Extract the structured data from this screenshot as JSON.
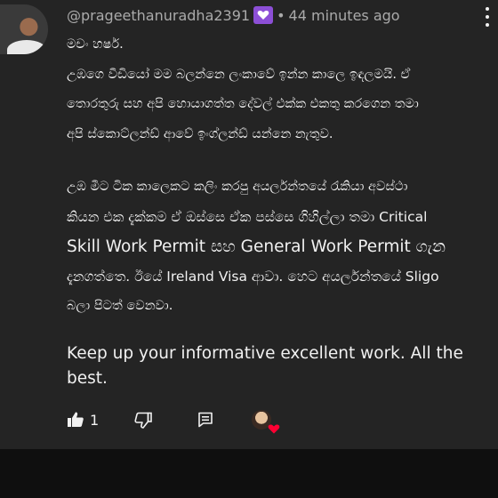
{
  "comment": {
    "author": "@prageethanuradha2391",
    "timestamp": "44 minutes ago",
    "body_lines": [
      {
        "text": "මචං හර්ෂ.",
        "lang": "si"
      },
      {
        "text": "උඹගෙ වීඩියෝ මම බලන්නෙ ලංකාවේ ඉන්න කාලෙ ඉඳලමයි.  ඒ",
        "lang": "si"
      },
      {
        "text": "තොරතුරු සහ අපි  හොයාගත්ත දේවල් එක්ක එකතු කරගෙන තමා",
        "lang": "si"
      },
      {
        "text": "අපි ස්කොට්ලන්ඩ් ආවේ ඉංග්ලන්ඩ් යන්නෙ නැතුව.",
        "lang": "si"
      },
      {
        "text": " උඹ මීට ටික කාලෙකට කලිං කරපු අයර්ලන්තයේ රැකියා අවස්ථා",
        "lang": "si"
      },
      {
        "text": "කියන එක දැක්කම ඒ ඔස්සෙ ඒක පස්සෙ ගිහිල්ලා තමා Critical",
        "lang": "mixed"
      },
      {
        "text": "Skill Work Permit සහ General Work Permit  ගැන",
        "lang": "mixed"
      },
      {
        "text": "දැනගත්තෙ. ඊයේ Ireland Visa ආවා. හෙට අයර්ලන්තයේ  Sligo",
        "lang": "mixed"
      },
      {
        "text": "බලා පිටත් වෙනවා.",
        "lang": "si"
      }
    ],
    "closing": "Keep up your informative excellent work. All the best.",
    "like_count": "1"
  },
  "icons": {
    "member_badge": "member-heart-badge-icon",
    "more": "more-vertical-icon",
    "like": "thumbs-up-icon",
    "dislike": "thumbs-down-icon",
    "reply": "reply-comment-icon",
    "creator_heart": "creator-heart-icon"
  },
  "colors": {
    "background": "#242424",
    "page": "#0f0f0f",
    "member_badge": "#8c4fd6",
    "heart": "#ff0033",
    "meta_text": "#aaaaaa"
  }
}
